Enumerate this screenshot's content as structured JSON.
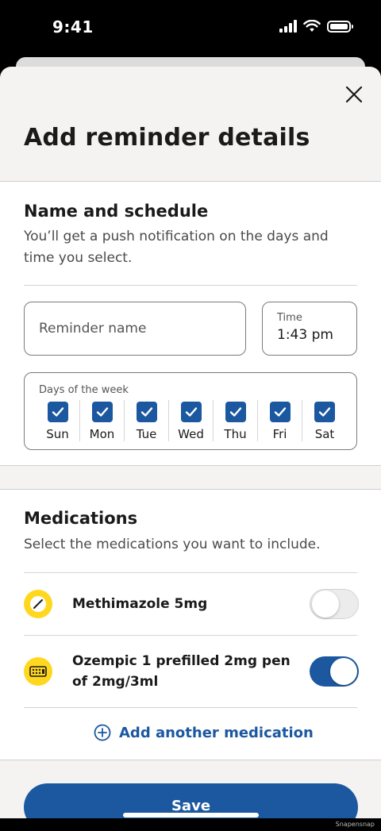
{
  "status_bar": {
    "time": "9:41"
  },
  "sheet": {
    "title": "Add reminder details",
    "close_icon": "close-icon"
  },
  "schedule": {
    "title": "Name and schedule",
    "description": "You’ll get a push notification on the days and time you select.",
    "reminder_name": {
      "value": "",
      "placeholder": "Reminder name"
    },
    "time": {
      "label": "Time",
      "value": "1:43 pm"
    },
    "days": {
      "label": "Days of the week",
      "items": [
        {
          "label": "Sun",
          "checked": true
        },
        {
          "label": "Mon",
          "checked": true
        },
        {
          "label": "Tue",
          "checked": true
        },
        {
          "label": "Wed",
          "checked": true
        },
        {
          "label": "Thu",
          "checked": true
        },
        {
          "label": "Fri",
          "checked": true
        },
        {
          "label": "Sat",
          "checked": true
        }
      ]
    }
  },
  "medications": {
    "title": "Medications",
    "description": "Select the medications you want to include.",
    "items": [
      {
        "name": "Methimazole 5mg",
        "icon": "pill-icon",
        "enabled": false
      },
      {
        "name": "Ozempic 1 prefilled 2mg pen of 2mg/3ml",
        "icon": "pen-injector-icon",
        "enabled": true
      }
    ],
    "add_label": "Add another medication"
  },
  "save_label": "Save",
  "watermark": "Snapensnap",
  "colors": {
    "accent": "#1b58a0",
    "med_icon": "#ffd71e",
    "sheet_bg": "#f4f3f1"
  }
}
